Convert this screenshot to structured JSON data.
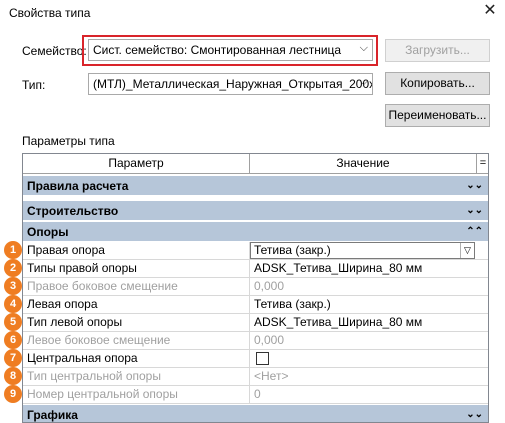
{
  "window": {
    "title": "Свойства типа"
  },
  "family": {
    "label": "Семейство:",
    "value": "Сист. семейство: Смонтированная лестница",
    "load_button": "Загрузить..."
  },
  "type": {
    "label": "Тип:",
    "value": "(МТЛ)_Металлическая_Наружная_Открытая_200x",
    "copy_button": "Копировать...",
    "rename_button": "Переименовать..."
  },
  "params_title": "Параметры типа",
  "grid": {
    "col_param": "Параметр",
    "col_value": "Значение",
    "col_eq": "=",
    "groups": {
      "calc": "Правила расчета",
      "build": "Строительство",
      "supports": "Опоры",
      "graphics": "Графика"
    },
    "rows": [
      {
        "num": "1",
        "param": "Правая опора",
        "value": "Тетива (закр.)"
      },
      {
        "num": "2",
        "param": "Типы правой опоры",
        "value": "ADSK_Тетива_Ширина_80 мм"
      },
      {
        "num": "3",
        "param": "Правое боковое смещение",
        "value": "0,000"
      },
      {
        "num": "4",
        "param": "Левая опора",
        "value": "Тетива (закр.)"
      },
      {
        "num": "5",
        "param": "Тип левой опоры",
        "value": "ADSK_Тетива_Ширина_80 мм"
      },
      {
        "num": "6",
        "param": "Левое боковое смещение",
        "value": "0,000"
      },
      {
        "num": "7",
        "param": "Центральная опора",
        "value": ""
      },
      {
        "num": "8",
        "param": "Тип центральной опоры",
        "value": "<Нет>"
      },
      {
        "num": "9",
        "param": "Номер центральной опоры",
        "value": "0"
      }
    ]
  },
  "colors": {
    "highlight": "#d9242a",
    "badge": "#ef7d22",
    "group_bg": "#b6c6d9"
  }
}
